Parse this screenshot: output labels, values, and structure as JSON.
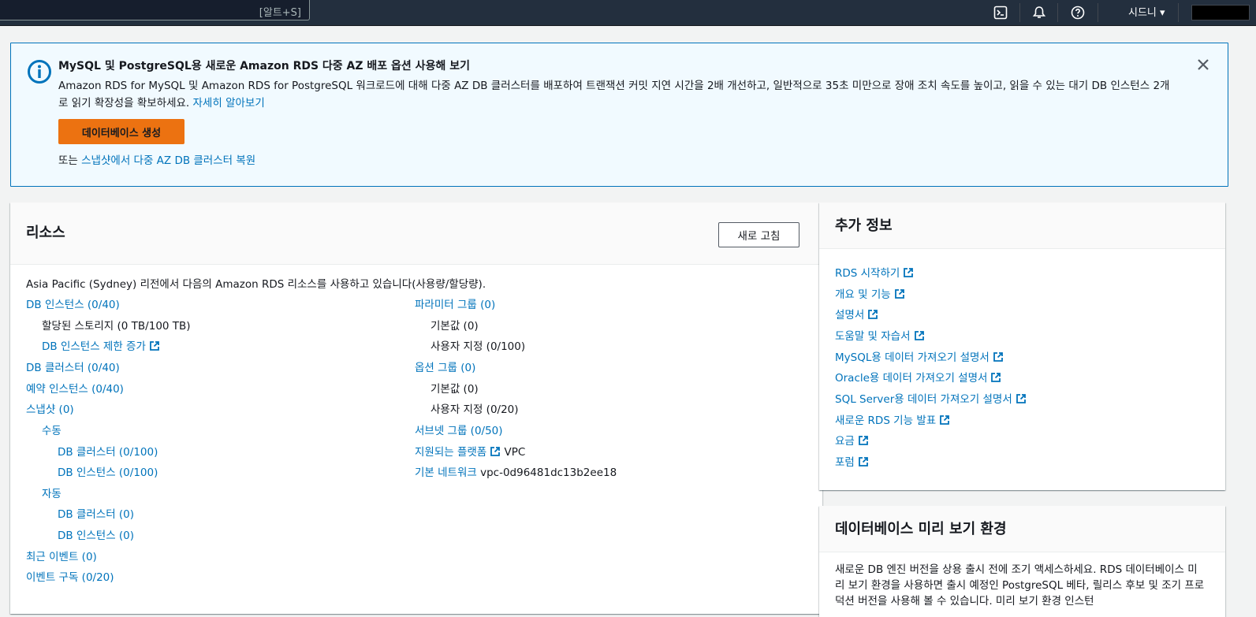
{
  "nav": {
    "search_shortcut": "[알트+S]",
    "region": "시드니 ▾"
  },
  "banner": {
    "title": "MySQL 및 PostgreSQL용 새로운 Amazon RDS 다중 AZ 배포 옵션 사용해 보기",
    "text": "Amazon RDS for MySQL 및 Amazon RDS for PostgreSQL 워크로드에 대해 다중 AZ DB 클러스터를 배포하여 트랜잭션 커밋 지연 시간을 2배 개선하고, 일반적으로 35초 미만으로 장애 조치 속도를 높이고, 읽을 수 있는 대기 DB 인스턴스 2개로 읽기 확장성을 확보하세요.",
    "learn_more": "자세히 알아보기",
    "create_db_button": "데이터베이스 생성",
    "or_text": "또는",
    "restore_link": "스냅샷에서 다중 AZ DB 클러스터 복원"
  },
  "resources": {
    "title": "리소스",
    "refresh_button": "새로 고침",
    "intro": "Asia Pacific (Sydney) 리전에서 다음의 Amazon RDS 리소스를 사용하고 있습니다(사용량/할당량).",
    "left": {
      "db_instances": "DB 인스턴스 (0/40)",
      "allocated_storage": "할당된 스토리지 (0 TB/100 TB)",
      "db_instance_limit_increase": "DB 인스턴스 제한 증가",
      "db_clusters": "DB 클러스터 (0/40)",
      "reserved_instances": "예약 인스턴스 (0/40)",
      "snapshots": "스냅샷 (0)",
      "manual": "수동",
      "manual_db_clusters": "DB 클러스터 (0/100)",
      "manual_db_instances": "DB 인스턴스 (0/100)",
      "automated": "자동",
      "auto_db_clusters": "DB 클러스터 (0)",
      "auto_db_instances": "DB 인스턴스 (0)",
      "recent_events": "최근 이벤트 (0)",
      "event_subscriptions": "이벤트 구독 (0/20)"
    },
    "right": {
      "parameter_groups": "파라미터 그룹 (0)",
      "pg_default": "기본값 (0)",
      "pg_custom": "사용자 지정 (0/100)",
      "option_groups": "옵션 그룹 (0)",
      "og_default": "기본값 (0)",
      "og_custom": "사용자 지정 (0/20)",
      "subnet_groups": "서브넷 그룹 (0/50)",
      "supported_platforms": "지원되는 플랫폼",
      "supported_platforms_value": "VPC",
      "default_network": "기본 네트워크",
      "default_network_value": "vpc-0d96481dc13b2ee18"
    }
  },
  "more_info": {
    "title": "추가 정보",
    "links": [
      "RDS 시작하기",
      "개요 및 기능",
      "설명서",
      "도움말 및 자습서",
      "MySQL용 데이터 가져오기 설명서",
      "Oracle용 데이터 가져오기 설명서",
      "SQL Server용 데이터 가져오기 설명서",
      "새로운 RDS 기능 발표",
      "요금",
      "포럼"
    ]
  },
  "preview": {
    "title": "데이터베이스 미리 보기 환경",
    "text": "새로운 DB 엔진 버전을 상용 출시 전에 조기 액세스하세요. RDS 데이터베이스 미리 보기 환경을 사용하면 출시 예정인 PostgreSQL 베타, 릴리스 후보 및 조기 프로덕션 버전을 사용해 볼 수 있습니다. 미리 보기 환경 인스턴"
  },
  "colors": {
    "nav_bg": "#232f3e",
    "link": "#0073bb",
    "primary_button": "#ec7211",
    "banner_bg": "#f1faff"
  }
}
